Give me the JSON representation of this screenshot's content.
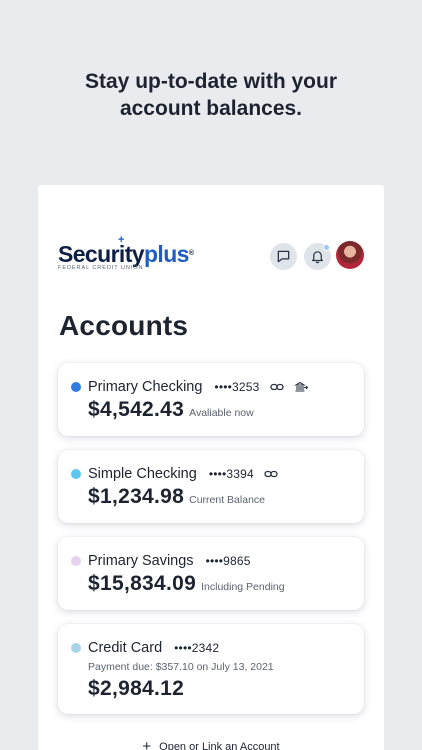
{
  "promo": {
    "headline_line1": "Stay up-to-date with your",
    "headline_line2": "account balances."
  },
  "header": {
    "logo": {
      "brand_main": "Security",
      "brand_accent": "plus",
      "registered": "®",
      "subtitle": "FEDERAL CREDIT UNION"
    },
    "icons": [
      "chat-icon",
      "bell-icon",
      "avatar"
    ],
    "notification_dot_color": "#9fc6ff"
  },
  "page": {
    "title": "Accounts"
  },
  "accounts": [
    {
      "name": "Primary Checking",
      "number": "••••3253",
      "amount": "$4,542.43",
      "note": "Avaliable now",
      "dot_color": "#2f7de1",
      "icons": [
        "link-icon",
        "bank-transfer-icon"
      ]
    },
    {
      "name": "Simple Checking",
      "number": "••••3394",
      "amount": "$1,234.98",
      "note": "Current Balance",
      "dot_color": "#5cc8ef",
      "icons": [
        "link-icon"
      ]
    },
    {
      "name": "Primary Savings",
      "number": "••••9865",
      "amount": "$15,834.09",
      "note": "Including Pending",
      "dot_color": "#e6d2ee",
      "icons": []
    },
    {
      "name": "Credit Card",
      "number": "••••2342",
      "due": "Payment due: $357.10 on July 13, 2021",
      "amount": "$2,984.12",
      "note": "",
      "dot_color": "#a9d4e6",
      "icons": []
    }
  ],
  "footer": {
    "open_link_label": "Open or Link an Account",
    "open_link_icon": "plus-icon"
  }
}
